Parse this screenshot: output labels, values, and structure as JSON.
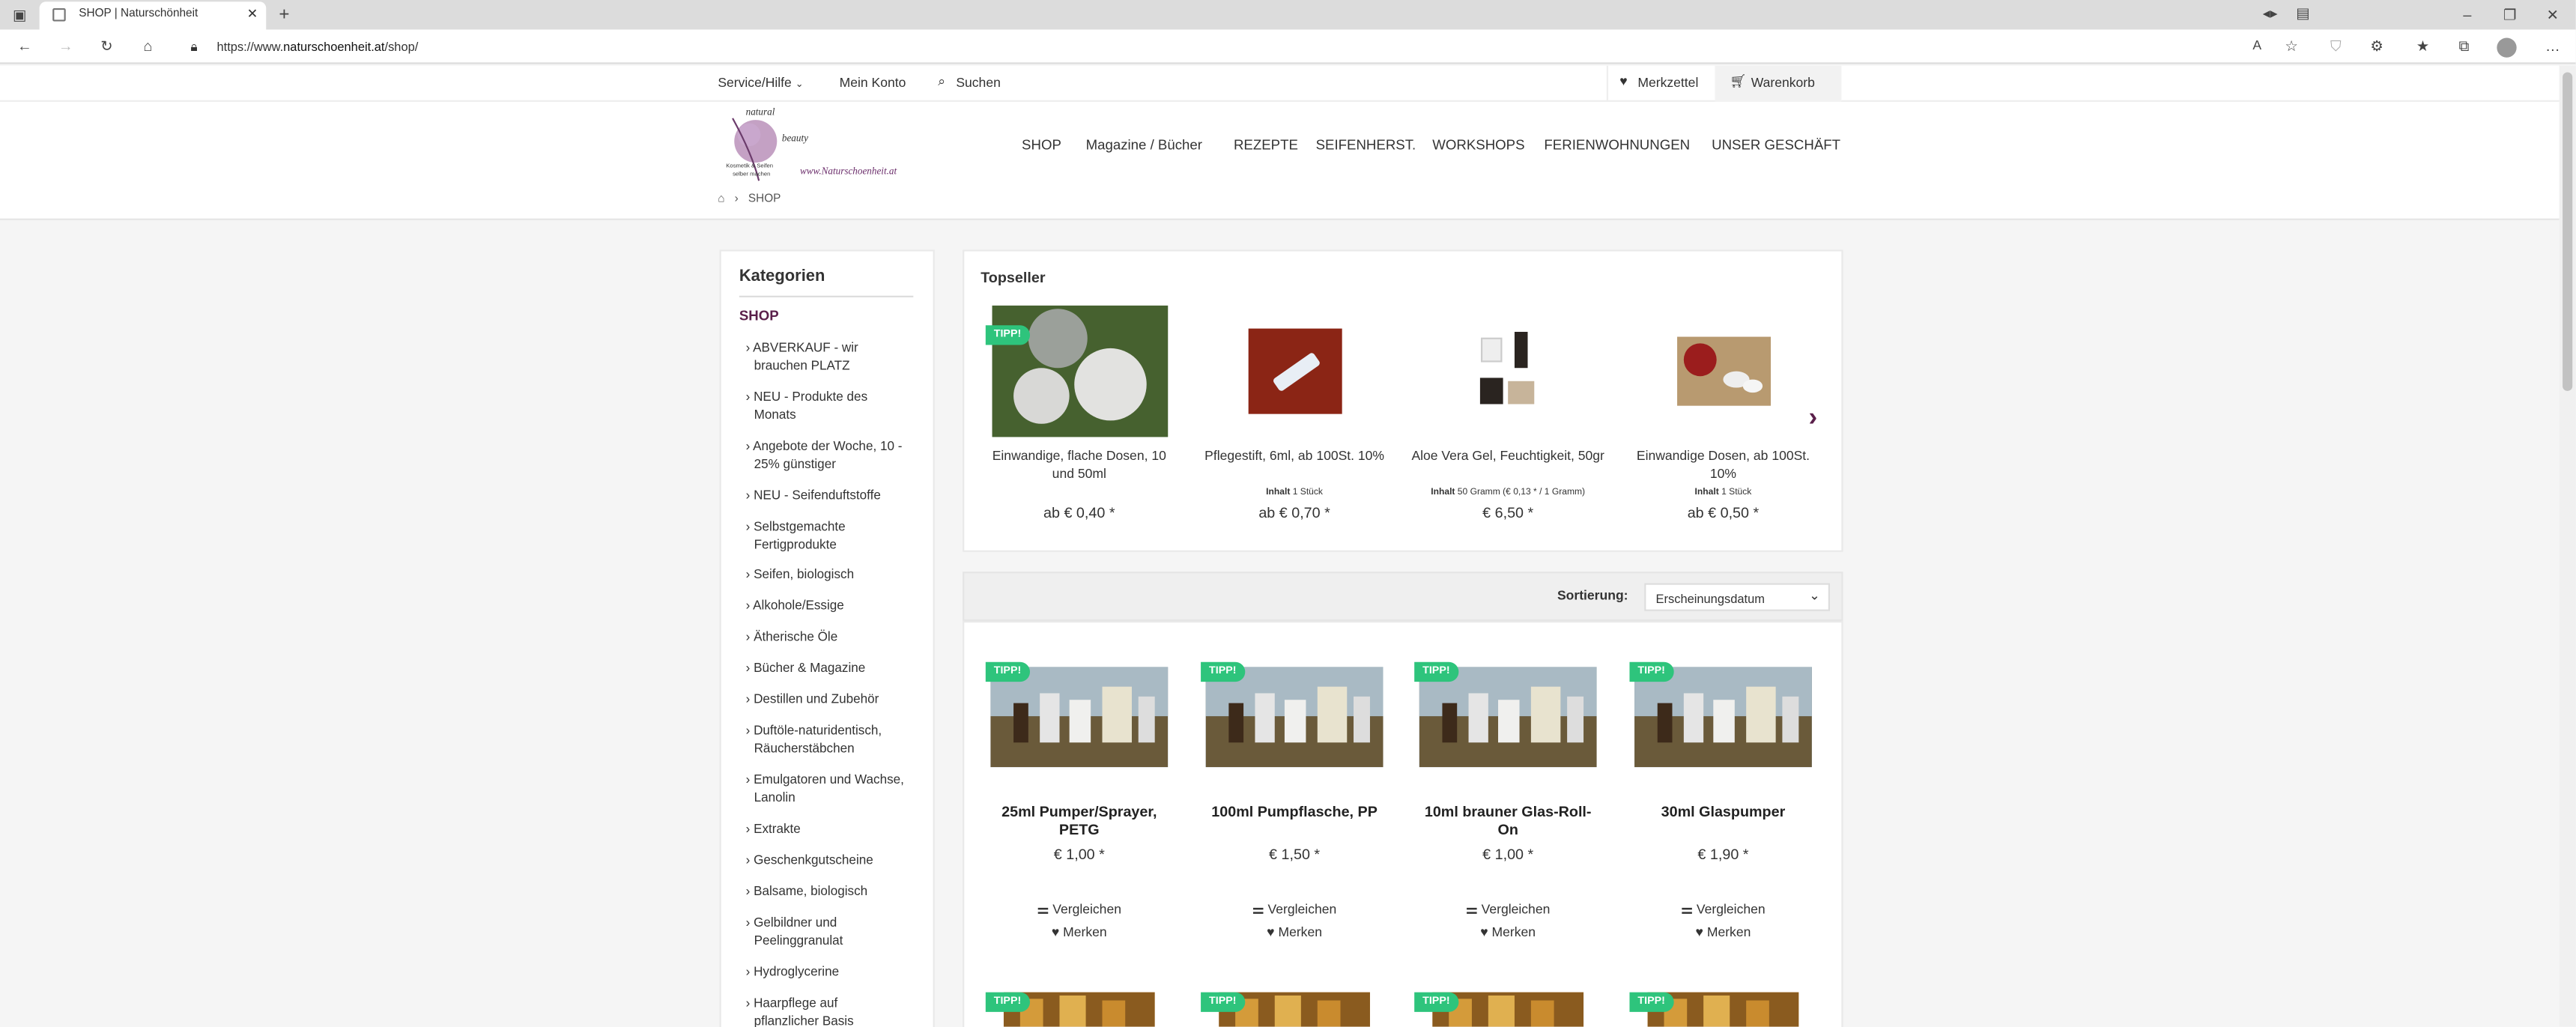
{
  "browser": {
    "tab_title": "SHOP | Naturschönheit",
    "url_prefix": "https://www.",
    "url_host": "naturschoenheit.at",
    "url_path": "/shop/"
  },
  "topnav": {
    "service": "Service/Hilfe",
    "account": "Mein Konto",
    "search": "Suchen",
    "wishlist": "Merkzettel",
    "cart": "Warenkorb"
  },
  "logo": {
    "line1": "natural",
    "line2": "beauty",
    "line3": "Kosmetik & Seifen",
    "line4": "selber machen",
    "site": "www.Naturschoenheit.at"
  },
  "mainnav": [
    "SHOP",
    "Magazine / Bücher",
    "REZEPTE",
    "SEIFENHERST.",
    "WORKSHOPS",
    "FERIENWOHNUNGEN",
    "UNSER GESCHÄFT"
  ],
  "breadcrumb": {
    "current": "SHOP"
  },
  "sidebar": {
    "title": "Kategorien",
    "active": "SHOP",
    "items": [
      [
        "› ABVERKAUF - wir",
        "brauchen PLATZ"
      ],
      [
        "› NEU - Produkte des",
        "Monats"
      ],
      [
        "› Angebote der Woche, 10 -",
        "25% günstiger"
      ],
      [
        "› NEU - Seifenduftstoffe"
      ],
      [
        "› Selbstgemachte",
        "Fertigprodukte"
      ],
      [
        "› Seifen, biologisch"
      ],
      [
        "› Alkohole/Essige"
      ],
      [
        "› Ätherische Öle"
      ],
      [
        "› Bücher & Magazine"
      ],
      [
        "› Destillen und Zubehör"
      ],
      [
        "› Duftöle-naturidentisch,",
        "Räucherstäbchen"
      ],
      [
        "› Emulgatoren und Wachse,",
        "Lanolin"
      ],
      [
        "› Extrakte"
      ],
      [
        "› Geschenkgutscheine"
      ],
      [
        "› Balsame, biologisch"
      ],
      [
        "› Gelbildner und",
        "Peelinggranulat"
      ],
      [
        "› Hydroglycerine"
      ],
      [
        "› Haarpflege auf",
        "pflanzlicher Basis"
      ]
    ]
  },
  "topseller": {
    "title": "Topseller",
    "badge": "TIPP!",
    "items": [
      {
        "name": [
          "Einwandige, flache Dosen, 10",
          "und 50ml"
        ],
        "hint_label": "",
        "hint": "",
        "price": "ab € 0,40 *"
      },
      {
        "name": [
          "Pflegestift, 6ml, ab 100St. 10%"
        ],
        "hint_label": "Inhalt",
        "hint": "1 Stück",
        "price": "ab € 0,70 *"
      },
      {
        "name": [
          "Aloe Vera Gel, Feuchtigkeit, 50gr"
        ],
        "hint_label": "Inhalt",
        "hint": "50 Gramm (€ 0,13 * / 1 Gramm)",
        "price": "€ 6,50 *"
      },
      {
        "name": [
          "Einwandige Dosen, ab 100St.",
          "10%"
        ],
        "hint_label": "Inhalt",
        "hint": "1 Stück",
        "price": "ab € 0,50 *"
      }
    ]
  },
  "sorting": {
    "label": "Sortierung:",
    "value": "Erscheinungsdatum"
  },
  "products": {
    "badge": "TIPP!",
    "compare": "Vergleichen",
    "remember": "Merken",
    "items": [
      {
        "name": [
          "25ml Pumper/Sprayer,",
          "PETG"
        ],
        "price": "€ 1,00 *"
      },
      {
        "name": [
          "100ml Pumpflasche, PP"
        ],
        "price": "€ 1,50 *"
      },
      {
        "name": [
          "10ml brauner Glas-Roll-",
          "On"
        ],
        "price": "€ 1,00 *"
      },
      {
        "name": [
          "30ml Glaspumper"
        ],
        "price": "€ 1,90 *"
      }
    ]
  },
  "colors": {
    "accent": "#5a1f4a",
    "badge": "#2ec47c"
  }
}
